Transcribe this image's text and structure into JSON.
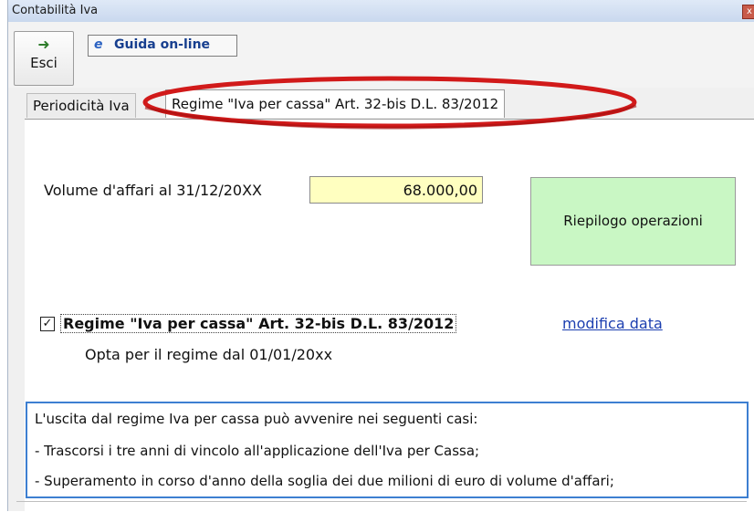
{
  "window": {
    "title": "Contabilità Iva",
    "close_label": "x"
  },
  "toolbar": {
    "exit_label": "Esci",
    "help_label": "Guida on-line",
    "help_icon": "e"
  },
  "tabs": [
    {
      "label": "Periodicità Iva"
    },
    {
      "label": "Regime \"Iva per cassa\" Art. 32-bis D.L. 83/2012"
    }
  ],
  "form": {
    "volume_label": "Volume d'affari al 31/12/20XX",
    "volume_value": "68.000,00",
    "summary_button": "Riepilogo operazioni",
    "checkbox_checked": true,
    "checkbox_mark": "✓",
    "checkbox_label": "Regime \"Iva per cassa\" Art. 32-bis D.L. 83/2012",
    "modify_link": "modifica data",
    "opt_text": "Opta per il regime dal 01/01/20xx"
  },
  "info": {
    "heading": "L'uscita dal regime Iva per cassa può avvenire nei seguenti casi:",
    "items": [
      "- Trascorsi i tre anni di vincolo all'applicazione dell'Iva per Cassa;",
      "- Superamento in corso d'anno della soglia dei due milioni di euro di volume d'affari;"
    ]
  },
  "colors": {
    "highlight_oval": "#d11a1a",
    "summary_bg": "#c9f7c4",
    "input_bg": "#ffffc0",
    "info_border": "#3d7fd1"
  }
}
